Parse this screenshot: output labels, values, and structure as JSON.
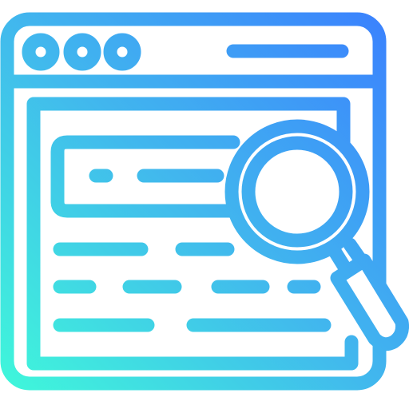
{
  "icon": {
    "name": "web-search-icon",
    "components": [
      "browser-window-icon",
      "magnifying-glass-icon"
    ]
  },
  "colors": {
    "gradient_start": "#3ffbd9",
    "gradient_mid": "#41b6ee",
    "gradient_end": "#3a7cff",
    "background": "#ffffff"
  }
}
